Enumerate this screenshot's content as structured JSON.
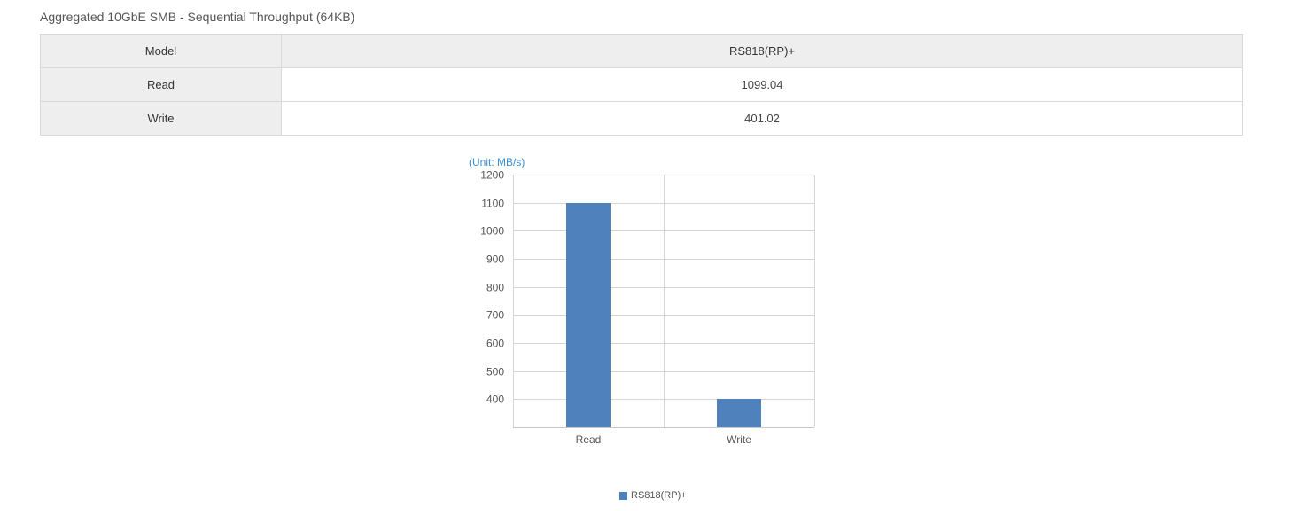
{
  "page": {
    "title": "Aggregated 10GbE SMB - Sequential Throughput (64KB)"
  },
  "table": {
    "header_label": "Model",
    "header_value": "RS818(RP)+",
    "rows": [
      {
        "label": "Read",
        "value": "1099.04"
      },
      {
        "label": "Write",
        "value": "401.02"
      }
    ]
  },
  "chart_data": {
    "type": "bar",
    "title": "",
    "unit_label": "(Unit: MB/s)",
    "xlabel": "",
    "ylabel": "",
    "categories": [
      "Read",
      "Write"
    ],
    "series": [
      {
        "name": "RS818(RP)+",
        "values": [
          1099.04,
          401.02
        ],
        "color": "#4f81bd"
      }
    ],
    "ylim": [
      300,
      1200
    ],
    "yticks": [
      400,
      500,
      600,
      700,
      800,
      900,
      1000,
      1100,
      1200
    ],
    "grid": true,
    "legend_position": "bottom"
  },
  "colors": {
    "bar": "#4f81bd",
    "grid": "#d6d6d6",
    "axis": "#c8c8c8",
    "unit_text": "#3a8fd1"
  }
}
